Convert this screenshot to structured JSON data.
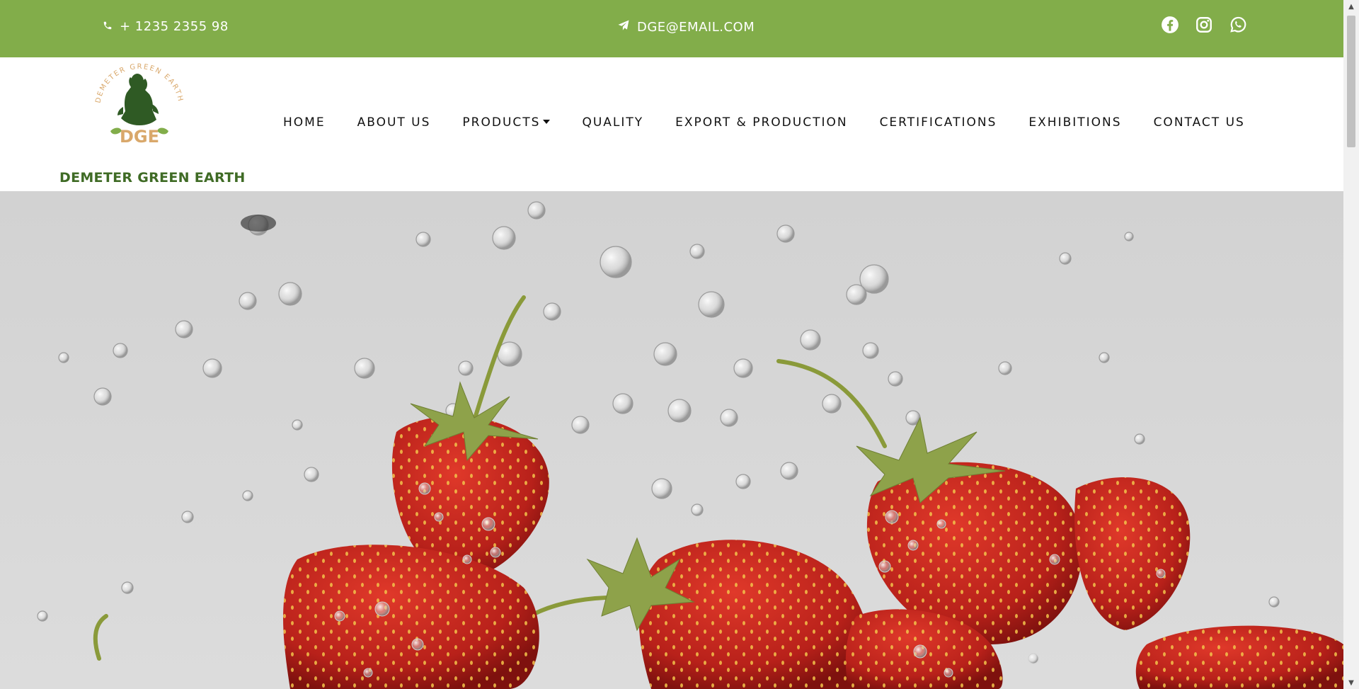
{
  "topbar": {
    "phone": "+ 1235 2355 98",
    "email": "DGE@EMAIL.COM",
    "social_icons": [
      "facebook-icon",
      "instagram-icon",
      "whatsapp-icon"
    ]
  },
  "brand": {
    "logo_ring_text": "DEMETER GREEN EARTH",
    "logo_initials": "DGE",
    "name": "DEMETER GREEN EARTH"
  },
  "nav": {
    "items": [
      {
        "label": "HOME"
      },
      {
        "label": "ABOUT US"
      },
      {
        "label": "PRODUCTS"
      },
      {
        "label": "QUALITY"
      },
      {
        "label": "EXPORT & PRODUCTION"
      },
      {
        "label": "CERTIFICATIONS"
      },
      {
        "label": "EXHIBITIONS"
      },
      {
        "label": "CONTACT US"
      }
    ]
  },
  "colors": {
    "topbar_bg": "#82ad4a",
    "brand_green": "#3f6b25",
    "logo_gold": "#d9a86b"
  }
}
